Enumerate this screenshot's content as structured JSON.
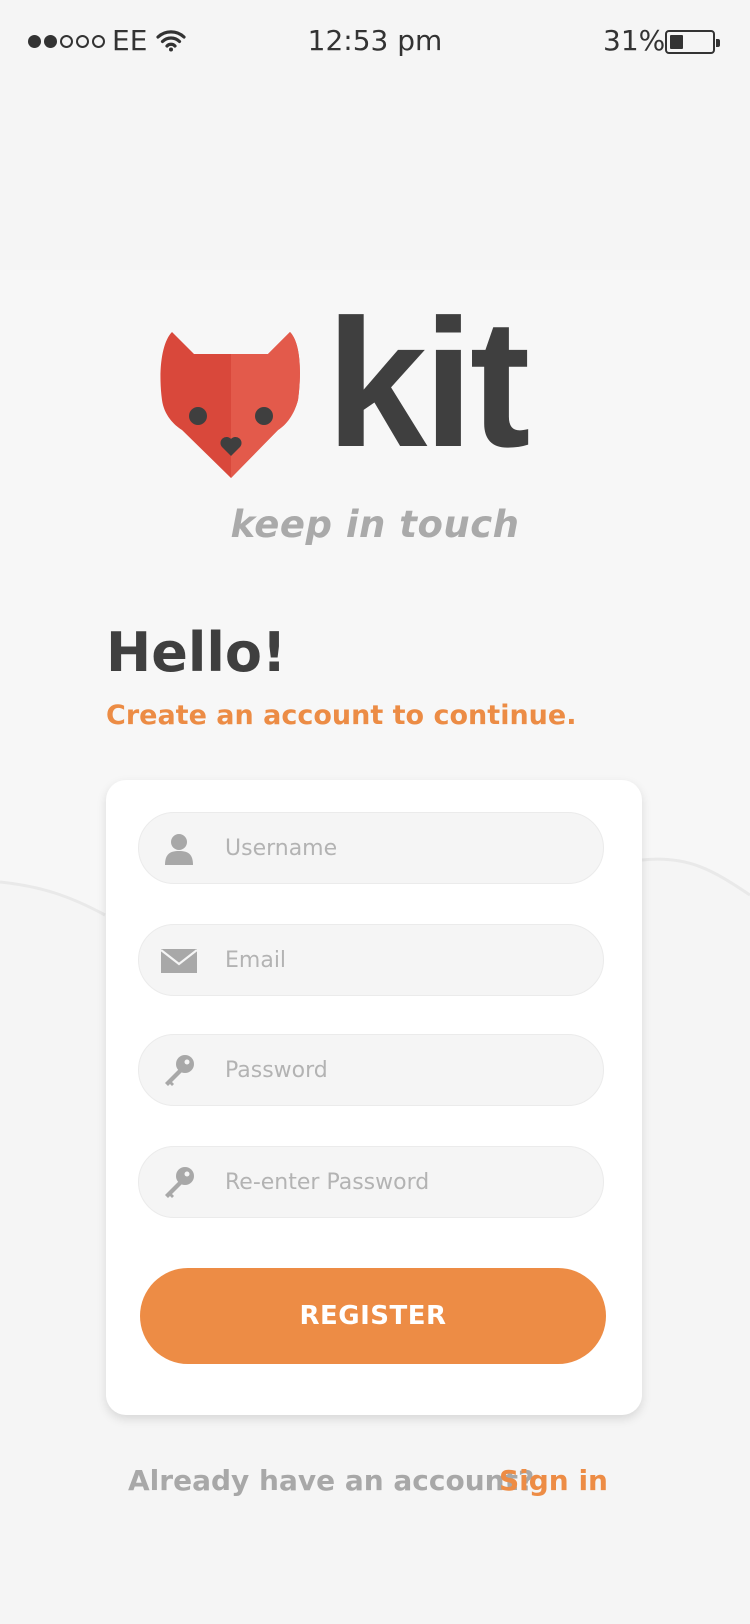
{
  "status_bar": {
    "carrier": "EE",
    "time": "12:53 pm",
    "battery": "31%",
    "battery_level": 0.31,
    "signal_bars_filled": 2,
    "signal_bars_total": 5
  },
  "brand": {
    "name": "kit",
    "tagline": "keep in touch",
    "logo_icon": "fox-icon",
    "logo_color": "#d9483b"
  },
  "heading": "Hello!",
  "subheading": "Create an account to continue.",
  "form": {
    "fields": [
      {
        "icon": "user-icon",
        "placeholder": "Username",
        "value": ""
      },
      {
        "icon": "envelope-icon",
        "placeholder": "Email",
        "value": ""
      },
      {
        "icon": "key-icon",
        "placeholder": "Password",
        "value": ""
      },
      {
        "icon": "key-icon",
        "placeholder": "Re-enter Password",
        "value": ""
      }
    ],
    "submit_label": "REGISTER"
  },
  "footer": {
    "prompt": "Already have an account?",
    "link_label": "Sign in"
  },
  "colors": {
    "accent": "#ed8c45",
    "text_dark": "#3f3f3f",
    "text_muted": "#a8a8a8",
    "background": "#f5f5f5"
  }
}
